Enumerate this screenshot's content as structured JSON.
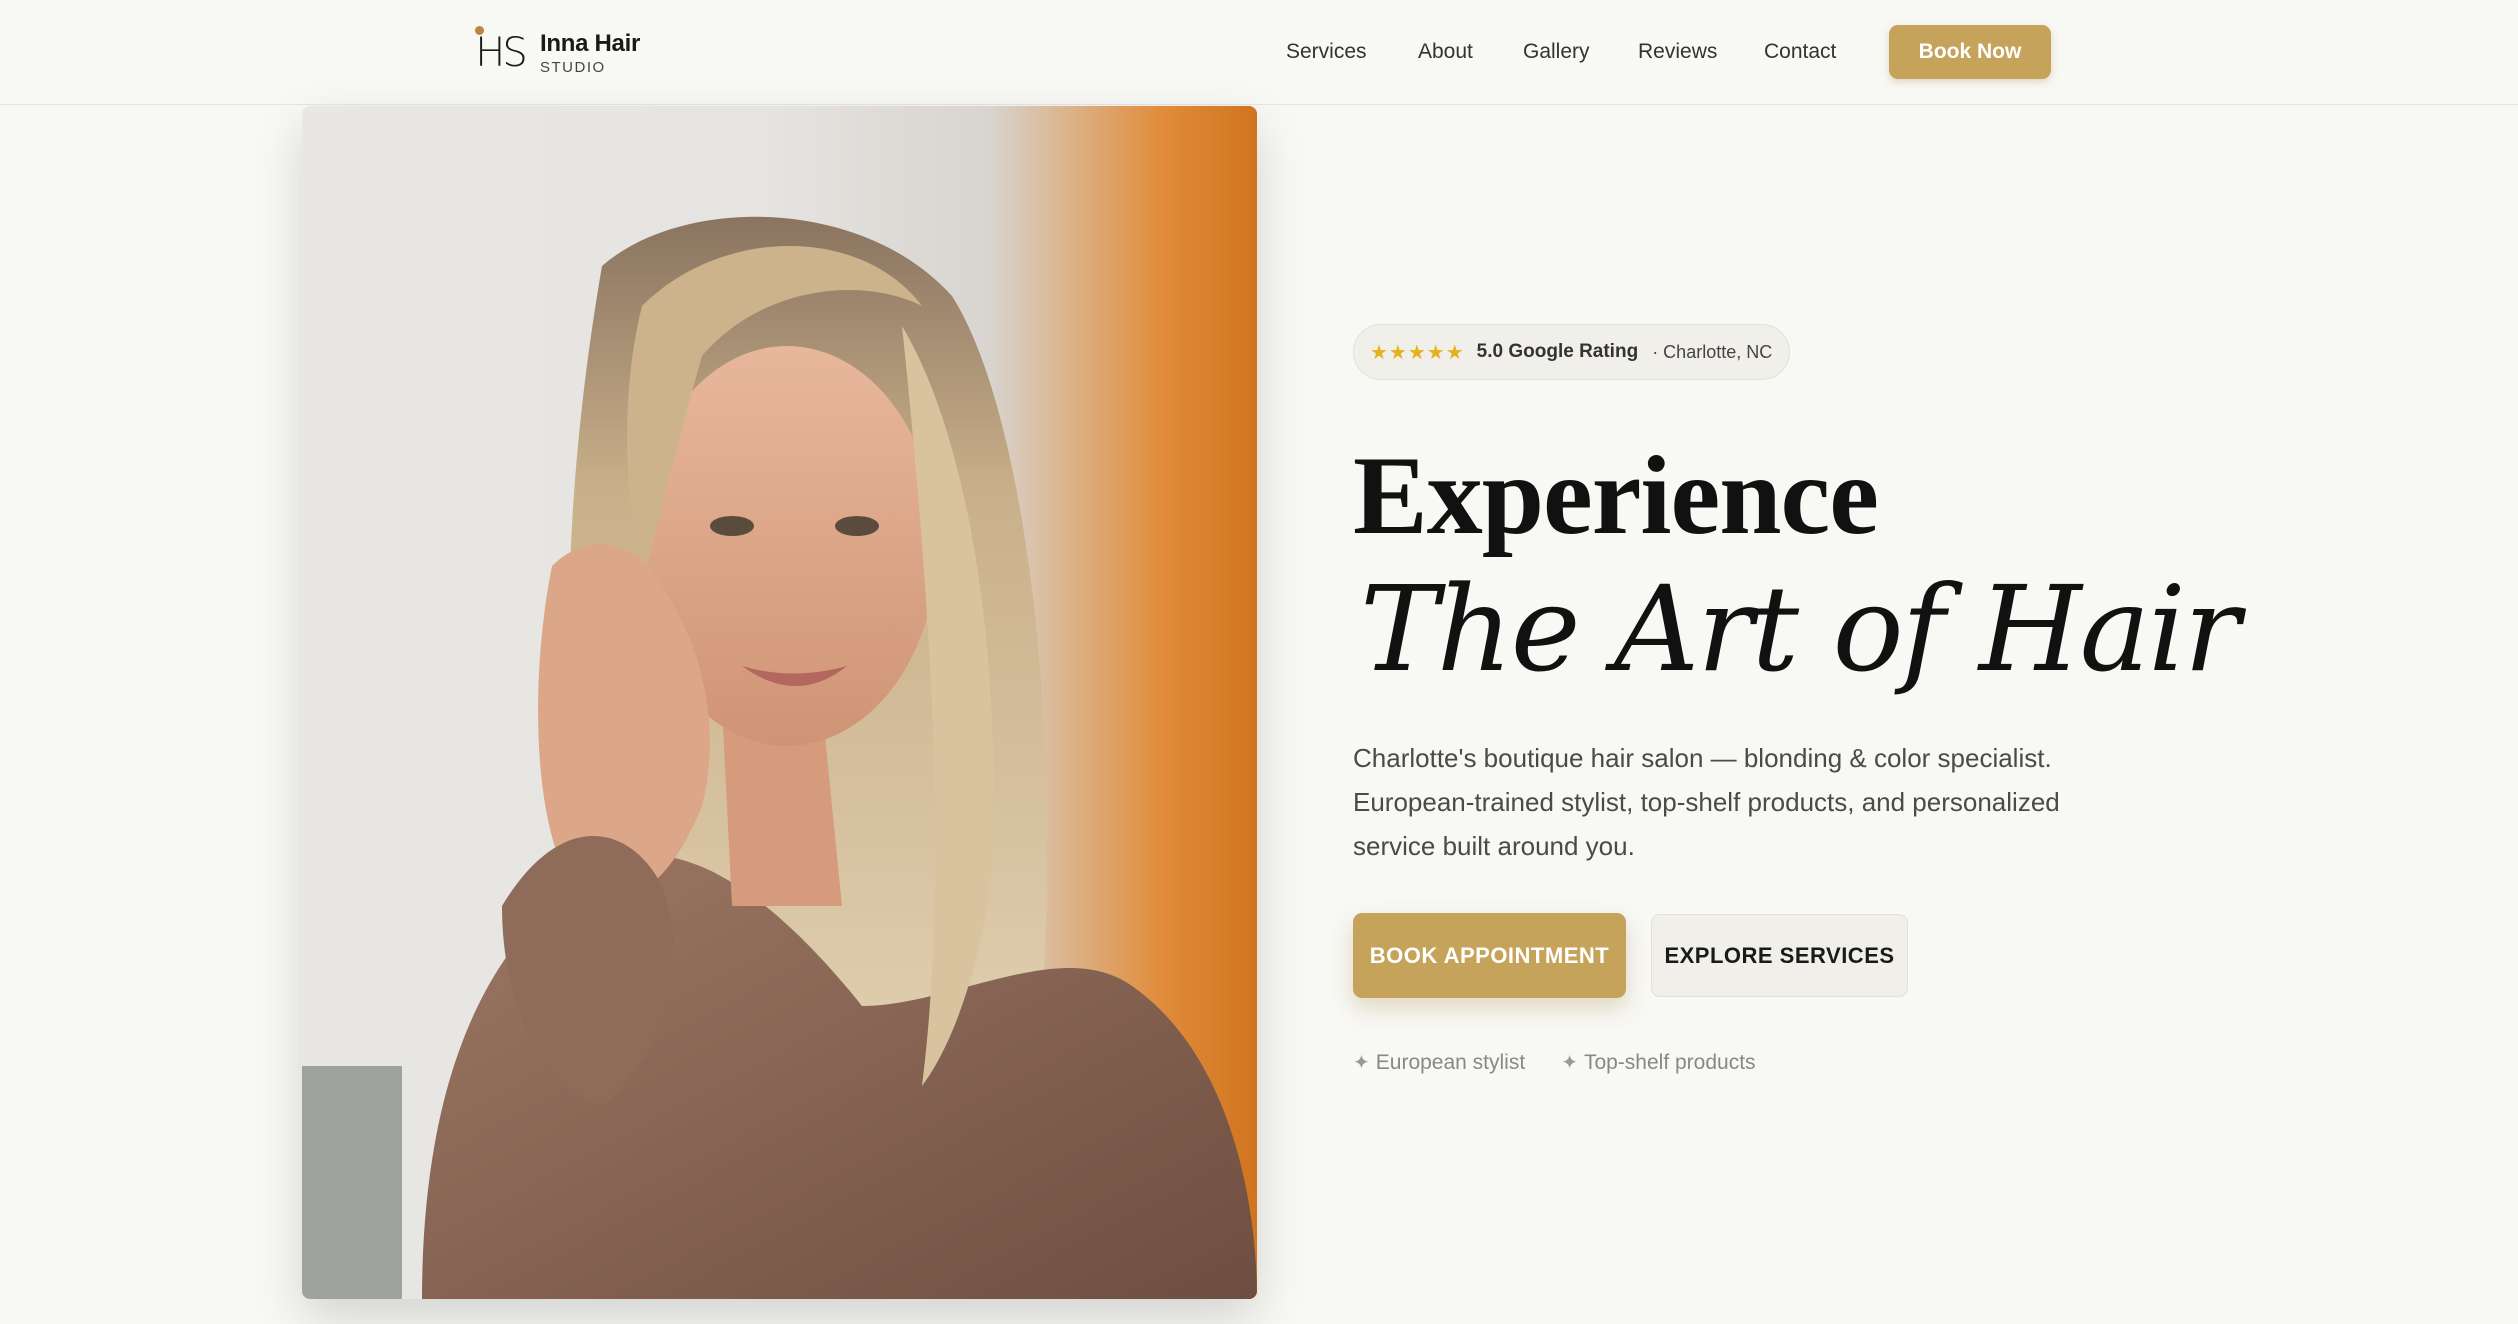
{
  "header": {
    "logo_letters": "HS",
    "brand_name": "Inna Hair",
    "brand_sub": "STUDIO",
    "nav": [
      {
        "label": "Services"
      },
      {
        "label": "About"
      },
      {
        "label": "Gallery"
      },
      {
        "label": "Reviews"
      },
      {
        "label": "Contact"
      }
    ],
    "cta_label": "Book Now"
  },
  "hero": {
    "rating": {
      "stars": "★★★★★",
      "text": "5.0 Google Rating",
      "location": "· Charlotte, NC"
    },
    "headline": "Experience",
    "headline_script": "The Art of Hair",
    "description": "Charlotte's boutique hair salon — blonding & color specialist. European-trained stylist, top-shelf products, and personalized service built around you.",
    "primary_button": "BOOK APPOINTMENT",
    "secondary_button": "EXPLORE SERVICES",
    "features": [
      {
        "icon": "✦",
        "label": "European stylist"
      },
      {
        "icon": "✦",
        "label": "Top-shelf products"
      }
    ]
  },
  "colors": {
    "accent": "#c6a35b",
    "background": "#f8f8f4",
    "star": "#e3b21e"
  }
}
